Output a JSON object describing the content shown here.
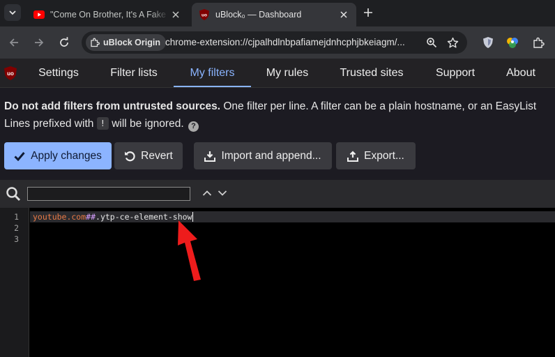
{
  "browser": {
    "tabs": [
      {
        "title": "\"Come On Brother, It's A Fake L",
        "favicon": "youtube-icon",
        "active": false
      },
      {
        "title": "uBlock₀ — Dashboard",
        "favicon": "ublock-icon",
        "active": true
      }
    ],
    "omnibox": {
      "site_chip": "uBlock Origin",
      "url": "chrome-extension://cjpalhdlnbpafiamejdnhcphjbkeiagm/..."
    }
  },
  "ublock": {
    "nav": [
      "Settings",
      "Filter lists",
      "My filters",
      "My rules",
      "Trusted sites",
      "Support",
      "About"
    ],
    "active_tab": "My filters",
    "info": {
      "warning_bold": "Do not add filters from untrusted sources.",
      "warning_rest": " One filter per line. A filter can be a plain hostname, or an EasyList",
      "line2_prefix": "Lines prefixed with ",
      "line2_kbd": "!",
      "line2_suffix": " will be ignored."
    },
    "buttons": {
      "apply": "Apply changes",
      "revert": "Revert",
      "import": "Import and append...",
      "export": "Export..."
    },
    "search": {
      "value": "",
      "placeholder": ""
    },
    "editor": {
      "line_numbers": [
        "1",
        "2",
        "3"
      ],
      "line1": {
        "host": "youtube.com",
        "sep": "##",
        "selector": ".ytp-ce-element-show"
      }
    }
  },
  "colors": {
    "accent": "#8ab4ff",
    "primary_button": "#8cb4ff",
    "annotation": "#ee1c1c",
    "hostname_token": "#e87a46"
  }
}
